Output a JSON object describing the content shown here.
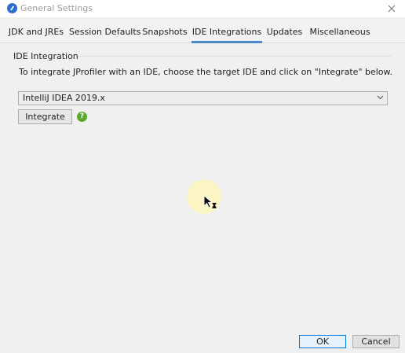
{
  "window": {
    "title": "General Settings",
    "icon": "jprofiler-app-icon",
    "close_icon": "close-icon"
  },
  "tabs": [
    {
      "label": "JDK and JREs",
      "active": false
    },
    {
      "label": "Session Defaults",
      "active": false
    },
    {
      "label": "Snapshots",
      "active": false
    },
    {
      "label": "IDE Integrations",
      "active": true
    },
    {
      "label": "Updates",
      "active": false
    },
    {
      "label": "Miscellaneous",
      "active": false
    }
  ],
  "ide_integration": {
    "section_title": "IDE Integration",
    "description": "To integrate JProfiler with an IDE, choose the target IDE and click on \"Integrate\" below.",
    "selected_ide": "IntelliJ IDEA 2019.x",
    "integrate_label": "Integrate",
    "help_icon": "help-icon",
    "help_glyph": "?"
  },
  "footer": {
    "ok_label": "OK",
    "cancel_label": "Cancel"
  },
  "colors": {
    "accent": "#4a88c7",
    "help_green": "#5aab2d",
    "ok_border": "#0078d7",
    "cursor_highlight": "#fcf5be"
  }
}
